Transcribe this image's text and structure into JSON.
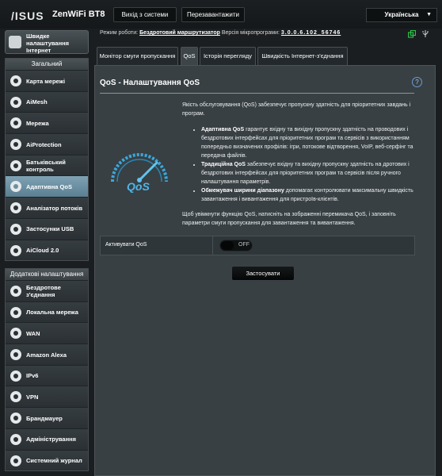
{
  "header": {
    "brand": "/ISUS",
    "model": "ZenWiFi BT8",
    "logout_label": "Вихід з системи",
    "reboot_label": "Перезавантажити",
    "language": "Українська"
  },
  "status": {
    "mode_label": "Режим роботи:",
    "mode_value": "Бездротовий маршрутизатор",
    "fw_label": "Версія мікропрограми:",
    "fw_value": "3.0.0.6.102_56746"
  },
  "sidebar": {
    "quick_setup": "Швидке налаштування Інтернет",
    "general_title": "Загальний",
    "general_items": [
      {
        "label": "Карта мережі",
        "icon": "network-map-icon"
      },
      {
        "label": "AiMesh",
        "icon": "aimesh-icon"
      },
      {
        "label": "Мережа",
        "icon": "network-icon"
      },
      {
        "label": "AiProtection",
        "icon": "aiprotection-icon"
      },
      {
        "label": "Батьківський контроль",
        "icon": "parental-control-icon"
      },
      {
        "label": "Адаптивна QoS",
        "icon": "qos-icon",
        "active": true
      },
      {
        "label": "Аналізатор потоків",
        "icon": "traffic-analyzer-icon"
      },
      {
        "label": "Застосунки USB",
        "icon": "usb-icon"
      },
      {
        "label": "AiCloud 2.0",
        "icon": "aicloud-icon"
      }
    ],
    "advanced_title": "Додаткові налаштування",
    "advanced_items": [
      {
        "label": "Бездротове з'єднання",
        "icon": "wireless-icon"
      },
      {
        "label": "Локальна мережа",
        "icon": "lan-icon"
      },
      {
        "label": "WAN",
        "icon": "wan-icon"
      },
      {
        "label": "Amazon Alexa",
        "icon": "alexa-icon"
      },
      {
        "label": "IPv6",
        "icon": "ipv6-icon"
      },
      {
        "label": "VPN",
        "icon": "vpn-icon"
      },
      {
        "label": "Брандмауер",
        "icon": "firewall-icon"
      },
      {
        "label": "Адміністрування",
        "icon": "admin-icon"
      },
      {
        "label": "Системний журнал",
        "icon": "syslog-icon"
      }
    ]
  },
  "tabs": [
    {
      "label": "Монітор смуги пропускання"
    },
    {
      "label": "QoS",
      "active": true
    },
    {
      "label": "Історія перегляду"
    },
    {
      "label": "Швидкість Інтернет-з'єднання"
    }
  ],
  "main": {
    "title": "QoS - Налаштування QoS",
    "intro": "Якість обслуговування (QoS) забезпечує пропускну здатність для пріоритетних завдань і програм.",
    "bullets": [
      {
        "head": "Адаптивна QoS",
        "text": " гарантує вхідну та вихідну пропускну здатність на проводових і бездротових інтерфейсах для пріоритетних програм та сервісів з використанням попередньо визначених профілів: ігри, потокове відтворення, VoIP, веб-серфінг та передача файлів."
      },
      {
        "head": "Традиційна QoS",
        "text": " забезпечує вхідну та вихідну пропускну здатність на дротових і бездротових інтерфейсах для пріоритетних програм та сервісів після ручного налаштування параметрів."
      },
      {
        "head": "Обмежувач ширини діапазону",
        "text": " допомагає контролювати максимальну швидкість завантаження і вивантаження для пристроїв-клієнтів."
      }
    ],
    "outro": "Щоб увімкнути функцію QoS, натисніть на зображенні перемикача QoS, і заповніть параметри смуги пропускання для завантаження та вивантаження.",
    "gauge_text": "QoS",
    "activate_label": "Активувати QoS",
    "toggle_state": "OFF",
    "apply_label": "Застосувати"
  },
  "colors": {
    "accent": "#4fb6e8",
    "active_item": "#6b8fa2"
  }
}
